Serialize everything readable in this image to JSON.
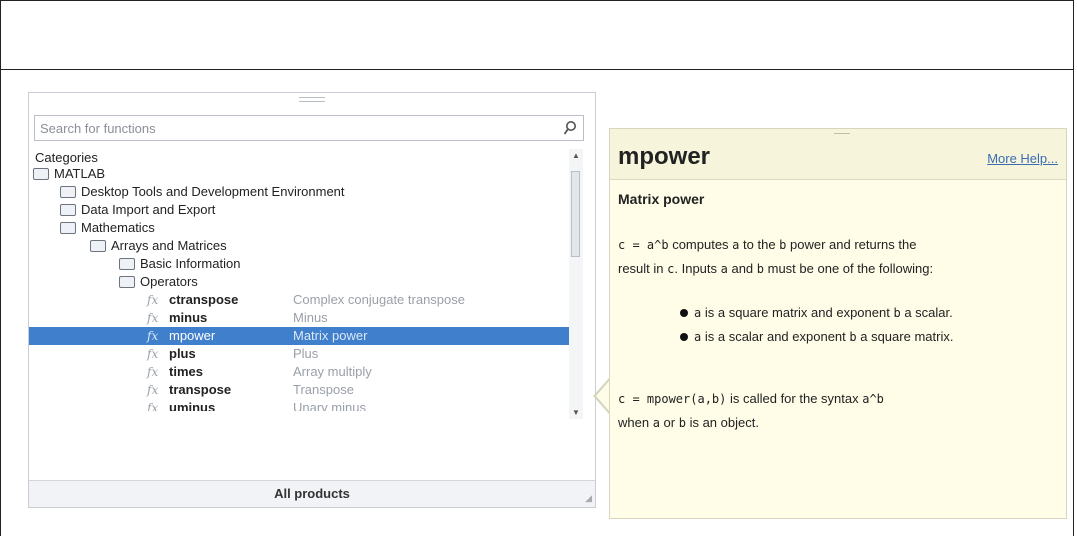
{
  "browser": {
    "search_placeholder": "Search for functions",
    "categories_label": "Categories",
    "tree": [
      {
        "label": "MATLAB",
        "level": 0
      },
      {
        "label": "Desktop Tools and Development Environment",
        "level": 1
      },
      {
        "label": "Data Import and Export",
        "level": 1
      },
      {
        "label": "Mathematics",
        "level": 1
      },
      {
        "label": "Arrays and Matrices",
        "level": 2
      },
      {
        "label": "Basic Information",
        "level": 3
      },
      {
        "label": "Operators",
        "level": 3
      }
    ],
    "functions": [
      {
        "fx": "fx",
        "name": "ctranspose",
        "desc": "Complex conjugate transpose"
      },
      {
        "fx": "fx",
        "name": "minus",
        "desc": "Minus"
      },
      {
        "fx": "fx",
        "name": "mpower",
        "desc": "Matrix power"
      },
      {
        "fx": "fx",
        "name": "plus",
        "desc": "Plus"
      },
      {
        "fx": "fx",
        "name": "times",
        "desc": "Array multiply"
      },
      {
        "fx": "fx",
        "name": "transpose",
        "desc": "Transpose"
      },
      {
        "fx": "fx",
        "name": "uminus",
        "desc": "Unary minus"
      }
    ],
    "selected_function": "mpower",
    "footer_label": "All products"
  },
  "help": {
    "title": "mpower",
    "more_help": "More Help...",
    "subtitle": "Matrix power",
    "p1_code": "c = a^b",
    "p1_text_a": " computes ",
    "p1_a": "a",
    "p1_text_b": " to the ",
    "p1_b": "b",
    "p1_text_c": " power and returns the",
    "p1_line2_a": "result in ",
    "p1_c": "c",
    "p1_line2_b": ". Inputs ",
    "p1_a2": "a",
    "p1_and": " and ",
    "p1_b2": "b",
    "p1_line2_c": " must be one of the following:",
    "bullet1_code_a": "a",
    "bullet1_text_a": " is a square matrix and exponent ",
    "bullet1_code_b": "b",
    "bullet1_text_b": " a scalar.",
    "bullet2_code_a": "a",
    "bullet2_text_a": " is a scalar and exponent ",
    "bullet2_code_b": "b",
    "bullet2_text_b": " a square matrix.",
    "p2_code": "c = mpower(a,b)",
    "p2_text_a": " is called for the syntax ",
    "p2_code2": "a^b",
    "p2_line2_a": "when ",
    "p2_a": "a",
    "p2_or": " or ",
    "p2_b": "b",
    "p2_line2_b": " is an object."
  },
  "colors": {
    "selection": "#3f7fcb",
    "help_bg": "#fffde8",
    "link": "#3b6db3"
  }
}
